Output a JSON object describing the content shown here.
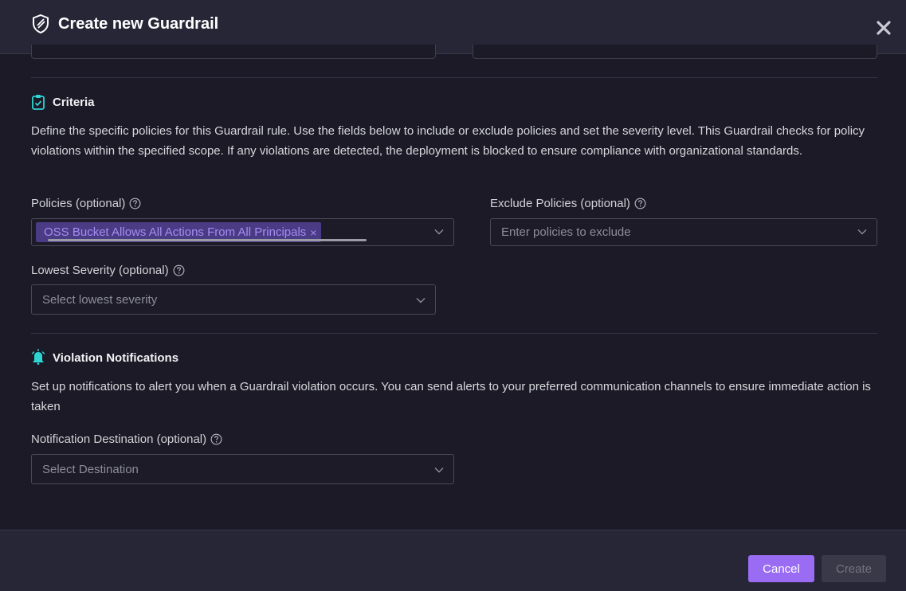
{
  "dialog": {
    "title": "Create new Guardrail"
  },
  "criteria": {
    "title": "Criteria",
    "description": "Define the specific policies for this Guardrail rule. Use the fields below to include or exclude policies and set the severity level. This Guardrail checks for policy violations within the specified scope. If any violations are detected, the deployment is blocked to ensure compliance with organizational standards.",
    "policies": {
      "label": "Policies (optional)",
      "selected_tag": "OSS Bucket Allows All Actions From All Principals",
      "tag_remove": "×"
    },
    "exclude_policies": {
      "label": "Exclude Policies (optional)",
      "placeholder": "Enter policies to exclude"
    },
    "lowest_severity": {
      "label": "Lowest Severity (optional)",
      "placeholder": "Select lowest severity"
    }
  },
  "notifications": {
    "title": "Violation Notifications",
    "description": "Set up notifications to alert you when a Guardrail violation occurs. You can send alerts to your preferred communication channels to ensure immediate action is taken",
    "destination": {
      "label": "Notification Destination (optional)",
      "placeholder": "Select Destination"
    }
  },
  "footer": {
    "cancel_label": "Cancel",
    "create_label": "Create"
  },
  "colors": {
    "accent": "#9a6cf3",
    "section_icon": "#2fd4d4",
    "background": "#1b1a26",
    "header": "#272637"
  },
  "icons": {
    "header": "shield-icon",
    "close": "close-icon",
    "criteria": "clipboard-check-icon",
    "notifications": "alarm-bell-icon",
    "help": "help-circle-icon",
    "dropdown": "chevron-down-icon"
  }
}
